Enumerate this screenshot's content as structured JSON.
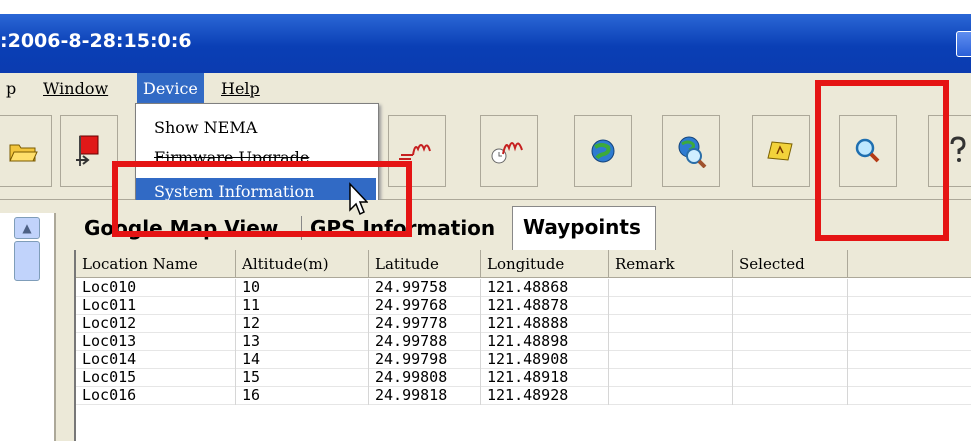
{
  "window": {
    "title": ":2006-8-28:15:0:6"
  },
  "menubar": {
    "items": [
      "p",
      "Window",
      "Device",
      "Help"
    ]
  },
  "device_menu": {
    "items": [
      "Show NEMA",
      "Firmware Upgrade",
      "System Information"
    ],
    "highlighted": "System Information"
  },
  "toolbar": {
    "icons": [
      "folder-icon",
      "flag-icon",
      "track-icon",
      "clock-track-icon",
      "globe-icon",
      "globe-search-icon",
      "note-icon",
      "magnifier-icon",
      "help-icon"
    ]
  },
  "tabs": [
    "Google Map View",
    "GPS Information",
    "Waypoints"
  ],
  "active_tab": "Waypoints",
  "table": {
    "columns": [
      "Location Name",
      "Altitude(m)",
      "Latitude",
      "Longitude",
      "Remark",
      "Selected"
    ],
    "rows": [
      [
        "Loc010",
        "10",
        "24.99758",
        "121.48868",
        "",
        ""
      ],
      [
        "Loc011",
        "11",
        "24.99768",
        "121.48878",
        "",
        ""
      ],
      [
        "Loc012",
        "12",
        "24.99778",
        "121.48888",
        "",
        ""
      ],
      [
        "Loc013",
        "13",
        "24.99788",
        "121.48898",
        "",
        ""
      ],
      [
        "Loc014",
        "14",
        "24.99798",
        "121.48908",
        "",
        ""
      ],
      [
        "Loc015",
        "15",
        "24.99808",
        "121.48918",
        "",
        ""
      ],
      [
        "Loc016",
        "16",
        "24.99818",
        "121.48928",
        "",
        ""
      ]
    ]
  },
  "colors": {
    "highlight": "#316ac5",
    "annotation_red": "#e51414",
    "titlebar_blue": "#0a3fb5"
  }
}
